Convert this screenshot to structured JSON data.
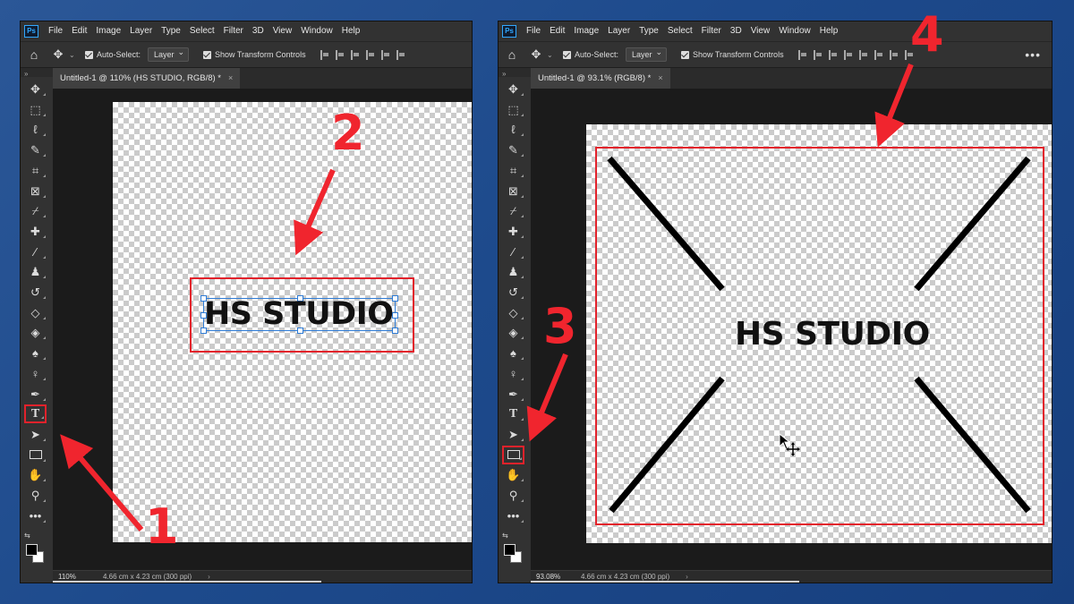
{
  "app": {
    "logo": "Ps",
    "menu": [
      "File",
      "Edit",
      "Image",
      "Layer",
      "Type",
      "Select",
      "Filter",
      "3D",
      "View",
      "Window",
      "Help"
    ],
    "options": {
      "auto_select_label": "Auto-Select:",
      "auto_select_value": "Layer",
      "show_transform_label": "Show Transform Controls",
      "panel_collapse": "»"
    },
    "colors": {
      "menu_bg": "#323232",
      "canvas_bg": "#1b1b1b",
      "highlight": "#e2222b"
    }
  },
  "left_window": {
    "tab_title": "Untitled-1 @ 110% (HS STUDIO, RGB/8) *",
    "tab_close": "×",
    "status_zoom": "110%",
    "status_info": "4.66 cm x 4.23 cm (300 ppi)",
    "status_chevron": "›",
    "canvas_text": "HS STUDIO",
    "selected_tool": "type-tool"
  },
  "right_window": {
    "tab_title": "Untitled-1 @ 93.1% (RGB/8) *",
    "tab_close": "×",
    "status_zoom": "93.08%",
    "status_info": "4.66 cm x 4.23 cm (300 ppi)",
    "status_chevron": "›",
    "canvas_text": "HS STUDIO",
    "selected_tool": "rectangle-tool",
    "more": "•••"
  },
  "tools": [
    {
      "name": "move-tool",
      "glyph": "✥"
    },
    {
      "name": "marquee-tool",
      "glyph": "⬚"
    },
    {
      "name": "lasso-tool",
      "glyph": "ℓ"
    },
    {
      "name": "quick-select-tool",
      "glyph": "✎"
    },
    {
      "name": "crop-tool",
      "glyph": "⌗"
    },
    {
      "name": "frame-tool",
      "glyph": "⊠"
    },
    {
      "name": "eyedropper-tool",
      "glyph": "⌿"
    },
    {
      "name": "healing-tool",
      "glyph": "✚"
    },
    {
      "name": "brush-tool",
      "glyph": "⁄"
    },
    {
      "name": "stamp-tool",
      "glyph": "♟"
    },
    {
      "name": "history-brush-tool",
      "glyph": "↺"
    },
    {
      "name": "eraser-tool",
      "glyph": "◇"
    },
    {
      "name": "bucket-tool",
      "glyph": "◈"
    },
    {
      "name": "blur-tool",
      "glyph": "♠"
    },
    {
      "name": "dodge-tool",
      "glyph": "♀"
    },
    {
      "name": "pen-tool",
      "glyph": "✒"
    },
    {
      "name": "type-tool",
      "glyph": "T"
    },
    {
      "name": "path-select-tool",
      "glyph": "➤"
    },
    {
      "name": "rectangle-tool",
      "glyph": "▭"
    },
    {
      "name": "hand-tool",
      "glyph": "✋"
    },
    {
      "name": "zoom-tool",
      "glyph": "⚲"
    },
    {
      "name": "more-tools",
      "glyph": "•••"
    }
  ],
  "annotations": {
    "step1": "1",
    "step2": "2",
    "step3": "3",
    "step4": "4",
    "color": "#f0252e"
  }
}
